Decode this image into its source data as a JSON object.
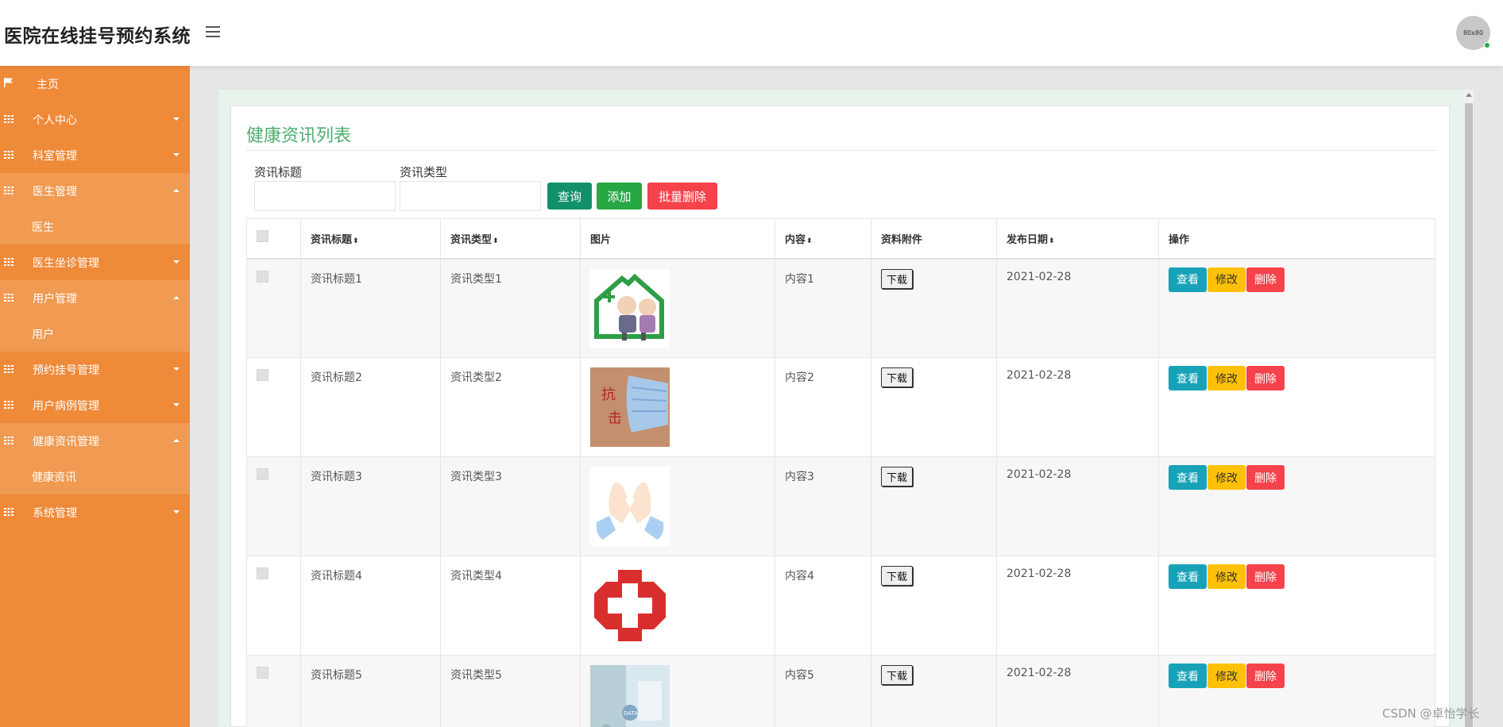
{
  "app": {
    "title": "医院在线挂号预约系统",
    "avatar_text": "80x80"
  },
  "sidebar": {
    "items": [
      {
        "label": "主页",
        "icon": "flag-icon"
      },
      {
        "label": "个人中心",
        "icon": "grid-icon",
        "caret": "down"
      },
      {
        "label": "科室管理",
        "icon": "grid-icon",
        "caret": "down"
      },
      {
        "label": "医生管理",
        "icon": "grid-icon",
        "caret": "up",
        "sub": "医生"
      },
      {
        "label": "医生坐诊管理",
        "icon": "grid-icon",
        "caret": "down"
      },
      {
        "label": "用户管理",
        "icon": "grid-icon",
        "caret": "up",
        "sub": "用户"
      },
      {
        "label": "预约挂号管理",
        "icon": "grid-icon",
        "caret": "down"
      },
      {
        "label": "用户病例管理",
        "icon": "grid-icon",
        "caret": "down"
      },
      {
        "label": "健康资讯管理",
        "icon": "grid-icon",
        "caret": "up",
        "sub": "健康资讯"
      },
      {
        "label": "系统管理",
        "icon": "grid-icon",
        "caret": "down"
      }
    ]
  },
  "main": {
    "title": "健康资讯列表",
    "search": {
      "title_label": "资讯标题",
      "title_value": "",
      "title_placeholder": "",
      "type_label": "资讯类型",
      "type_value": "",
      "type_placeholder": "",
      "query_label": "查询",
      "add_label": "添加",
      "batch_delete_label": "批量删除"
    },
    "table": {
      "columns": [
        "资讯标题",
        "资讯类型",
        "图片",
        "内容",
        "资料附件",
        "发布日期",
        "操作"
      ],
      "sort_glyph": "⬍",
      "download_label": "下载",
      "view_label": "查看",
      "edit_label": "修改",
      "delete_label": "删除",
      "rows": [
        {
          "title": "资讯标题1",
          "type": "资讯类型1",
          "image": "elderly-care-house-image",
          "content": "内容1",
          "date": "2021-02-28"
        },
        {
          "title": "资讯标题2",
          "type": "资讯类型2",
          "image": "face-mask-image",
          "content": "内容2",
          "date": "2021-02-28"
        },
        {
          "title": "资讯标题3",
          "type": "资讯类型3",
          "image": "heart-hands-image",
          "content": "内容3",
          "date": "2021-02-28"
        },
        {
          "title": "资讯标题4",
          "type": "资讯类型4",
          "image": "red-cross-image",
          "content": "内容4",
          "date": "2021-02-28"
        },
        {
          "title": "资讯标题5",
          "type": "资讯类型5",
          "image": "medical-data-image",
          "content": "内容5",
          "date": "2021-02-28"
        }
      ]
    }
  },
  "watermark": "CSDN @卓怡学长",
  "colors": {
    "sidebar": "#ef8a39",
    "sidebar_open": "#f09a52",
    "title_green": "#4cae6f",
    "query": "#12906a",
    "add": "#28a745",
    "delete": "#f5424b",
    "view": "#17a2b8",
    "edit": "#ffc107"
  }
}
